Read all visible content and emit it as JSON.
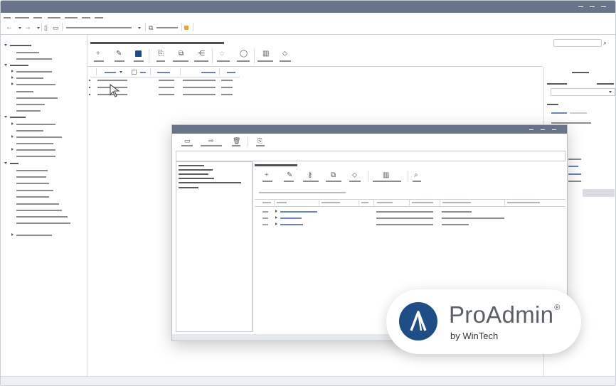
{
  "brand": {
    "name": "ProAdmin",
    "trademark": "®",
    "byline": "by WinTech",
    "logo_color": "#1f4e86"
  },
  "colors": {
    "titlebar": "#687489",
    "placeholder_text": "#8c8c8c",
    "link_text": "#6b83b6"
  },
  "main_window": {
    "window_controls": [
      "minimize-icon",
      "maximize-icon",
      "close-icon"
    ],
    "toolbar_icons": [
      "back-arrow-icon",
      "forward-arrow-icon",
      "new-document-icon",
      "open-folder-icon",
      "copy-icon",
      "highlight-icon"
    ],
    "action_icons": [
      "add-icon",
      "edit-icon",
      "run-icon",
      "export-icon",
      "duplicate-icon",
      "share-icon",
      "hide-icon",
      "view-icon",
      "columns-icon",
      "tag-icon"
    ]
  },
  "dialog": {
    "window_controls": [
      "minimize-icon",
      "maximize-icon",
      "close-icon"
    ],
    "toolbar_icons": [
      "calendar-icon",
      "move-icon",
      "delete-icon",
      "export-icon"
    ],
    "action_icons": [
      "add-icon",
      "edit-icon",
      "key-icon",
      "duplicate-icon",
      "tag-icon",
      "columns-icon",
      "search-icon"
    ]
  }
}
